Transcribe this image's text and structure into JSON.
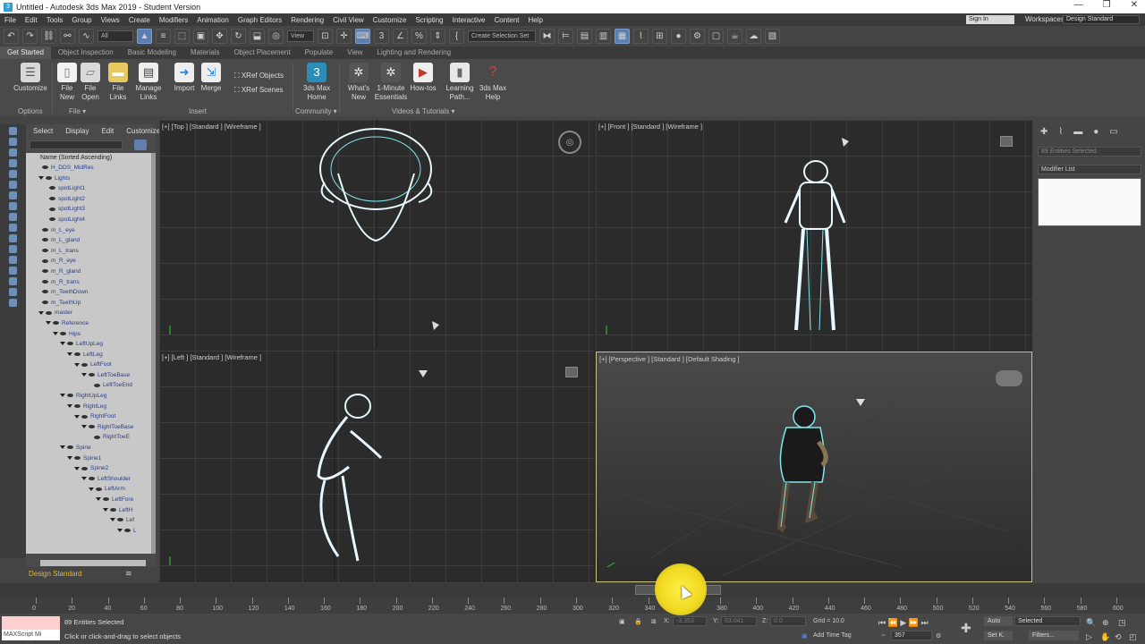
{
  "window": {
    "title": "Untitled - Autodesk 3ds Max 2019 - Student Version",
    "controls": [
      "—",
      "❐",
      "✕"
    ]
  },
  "menubar": {
    "items": [
      "File",
      "Edit",
      "Tools",
      "Group",
      "Views",
      "Create",
      "Modifiers",
      "Animation",
      "Graph Editors",
      "Rendering",
      "Civil View",
      "Customize",
      "Scripting",
      "Interactive",
      "Content",
      "Help"
    ],
    "signin": "Sign In",
    "workspaces_label": "Workspaces:",
    "workspace_value": "Design Standard"
  },
  "toolbar": {
    "filter_value": "All",
    "view_value": "View",
    "selection_set_placeholder": "Create Selection Set"
  },
  "ribbon": {
    "tabs": [
      "Get Started",
      "Object Inspection",
      "Basic Modeling",
      "Materials",
      "Object Placement",
      "Populate",
      "View",
      "Lighting and Rendering"
    ],
    "buttons": {
      "customize": "Customize",
      "file_new_1": "File",
      "file_new_2": "New",
      "file_open_1": "File",
      "file_open_2": "Open",
      "file_links_1": "File",
      "file_links_2": "Links",
      "manage_links_1": "Manage",
      "manage_links_2": "Links",
      "import": "Import",
      "merge": "Merge",
      "xref_objects": "XRef Objects",
      "xref_scenes": "XRef Scenes",
      "home_1": "3ds Max",
      "home_2": "Home",
      "whats_new_1": "What's",
      "whats_new_2": "New",
      "essentials_1": "1-Minute",
      "essentials_2": "Essentials",
      "howtos": "How-tos",
      "learning_1": "Learning",
      "learning_2": "Path...",
      "help_1": "3ds Max",
      "help_2": "Help"
    },
    "groups": {
      "options": "Options",
      "file": "File ▾",
      "insert": "Insert",
      "community": "Community ▾",
      "videos": "Videos & Tutorials ▾"
    }
  },
  "scene_explorer": {
    "tabs": [
      "Select",
      "Display",
      "Edit",
      "Customize"
    ],
    "header": "Name (Sorted Ascending)",
    "rows": [
      {
        "label": "H_DDS_MidRes"
      },
      {
        "label": "Lights"
      },
      {
        "label": "spotLight1"
      },
      {
        "label": "spotLight2"
      },
      {
        "label": "spotLight3"
      },
      {
        "label": "spotLight4"
      },
      {
        "label": "m_L_eye"
      },
      {
        "label": "m_L_gland"
      },
      {
        "label": "m_L_trans"
      },
      {
        "label": "m_R_eye"
      },
      {
        "label": "m_R_gland"
      },
      {
        "label": "m_R_trans"
      },
      {
        "label": "m_TeethDown"
      },
      {
        "label": "m_TeethUp"
      },
      {
        "label": "master"
      },
      {
        "label": "Reference"
      },
      {
        "label": "Hips"
      },
      {
        "label": "LeftUpLeg"
      },
      {
        "label": "LeftLeg"
      },
      {
        "label": "LeftFoot"
      },
      {
        "label": "LeftToeBase"
      },
      {
        "label": "LeftToeEnd"
      },
      {
        "label": "RightUpLeg"
      },
      {
        "label": "RightLeg"
      },
      {
        "label": "RightFoot"
      },
      {
        "label": "RightToeBase"
      },
      {
        "label": "RightToeE"
      },
      {
        "label": "Spine"
      },
      {
        "label": "Spine1"
      },
      {
        "label": "Spine2"
      },
      {
        "label": "LeftShoulder"
      },
      {
        "label": "LeftArm"
      },
      {
        "label": "LeftFore"
      },
      {
        "label": "LeftH"
      },
      {
        "label": "Lef"
      },
      {
        "label": "L"
      }
    ],
    "footer": "Design Standard"
  },
  "viewports": {
    "top": "[+] [Top ] [Standard ] [Wireframe ]",
    "front": "[+] [Front ] [Standard ] [Wireframe ]",
    "left": "[+] [Left ] [Standard ] [Wireframe ]",
    "perspective": "[+] [Perspective ] [Standard ] [Default Shading ]"
  },
  "command_panel": {
    "entities_placeholder": "89 Entities Selected",
    "modifier_list": "Modifier List"
  },
  "timeline": {
    "thumb": "357 / 600",
    "ticks": [
      "0",
      "20",
      "40",
      "60",
      "80",
      "100",
      "120",
      "140",
      "160",
      "180",
      "200",
      "220",
      "240",
      "260",
      "280",
      "300",
      "320",
      "340",
      "360",
      "380",
      "400",
      "420",
      "440",
      "460",
      "480",
      "500",
      "520",
      "540",
      "560",
      "580",
      "600"
    ]
  },
  "status": {
    "maxscript": "MAXScript Mi",
    "selection": "89 Entities Selected",
    "prompt": "Click or click-and-drag to select objects",
    "x_label": "X:",
    "x_value": "-3.353",
    "y_label": "Y:",
    "y_value": "63.041",
    "z_label": "Z:",
    "z_value": "0.0",
    "grid": "Grid = 10.0",
    "add_time_tag": "Add Time Tag",
    "auto": "Auto",
    "set_key": "Set K.",
    "selected": "Selected",
    "filters": "Filters...",
    "frame": "357"
  }
}
